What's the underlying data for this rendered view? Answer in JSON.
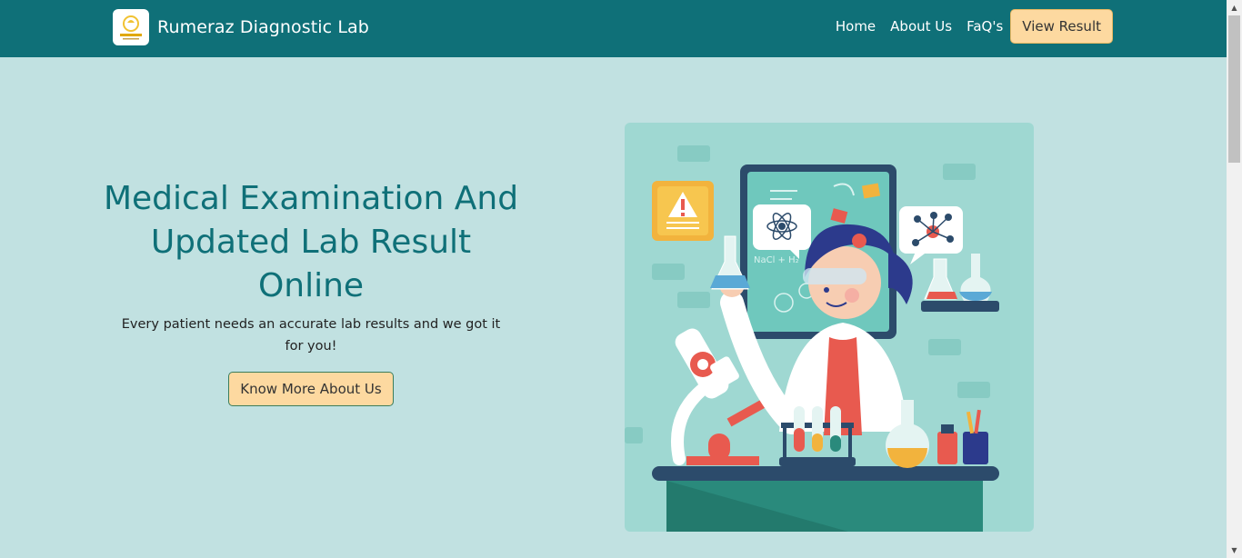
{
  "brand": {
    "name": "Rumeraz Diagnostic Lab",
    "logo": "lab-logo-icon"
  },
  "nav": {
    "links": [
      "Home",
      "About Us",
      "FaQ's"
    ],
    "cta": "View Result"
  },
  "hero": {
    "title": "Medical Examination And Updated Lab Result Online",
    "subtitle": "Every patient needs an accurate lab results and we got it for you!",
    "button": "Know More About Us",
    "illustration_text": {
      "formula": "NaCl + H₂"
    }
  },
  "colors": {
    "navbar": "#0f7078",
    "page_bg": "#c1e1e1",
    "accent": "#fdd9a0",
    "title": "#0f7078"
  }
}
